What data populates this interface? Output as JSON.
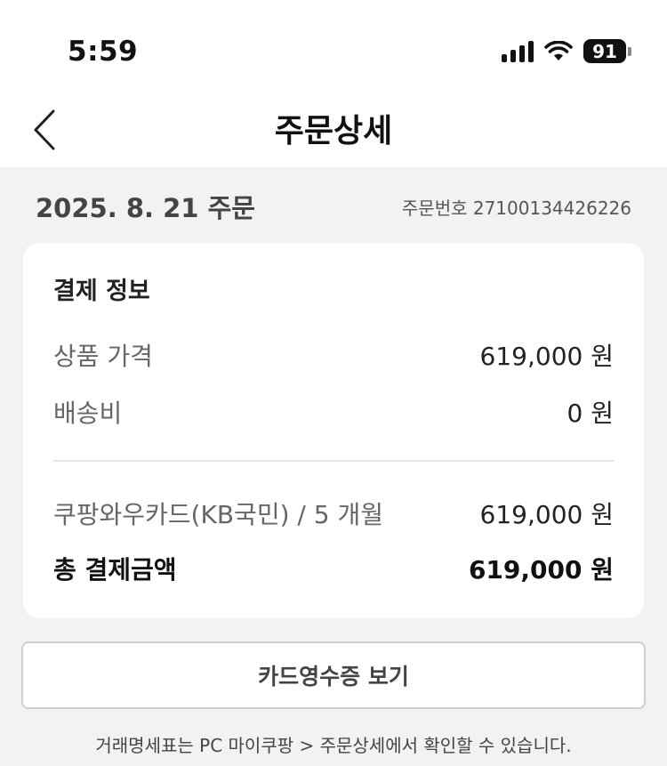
{
  "status_bar": {
    "time": "5:59",
    "battery": "91",
    "icons": [
      "signal-icon",
      "wifi-icon",
      "battery-icon"
    ]
  },
  "nav": {
    "back_icon": "chevron-left-icon",
    "title": "주문상세"
  },
  "order": {
    "date": "2025. 8. 21 주문",
    "number_label": "주문번호 27100134426226"
  },
  "payment": {
    "title": "결제 정보",
    "rows": [
      {
        "label": "상품 가격",
        "value": "619,000 원"
      },
      {
        "label": "배송비",
        "value": "0 원"
      }
    ],
    "method": {
      "label": "쿠팡와우카드(KB국민) / 5 개월",
      "value": "619,000 원"
    },
    "total": {
      "label": "총 결제금액",
      "value": "619,000 원"
    }
  },
  "receipt_button": "카드영수증 보기",
  "footnote": "거래명세표는 PC 마이쿠팡 > 주문상세에서 확인할 수 있습니다."
}
